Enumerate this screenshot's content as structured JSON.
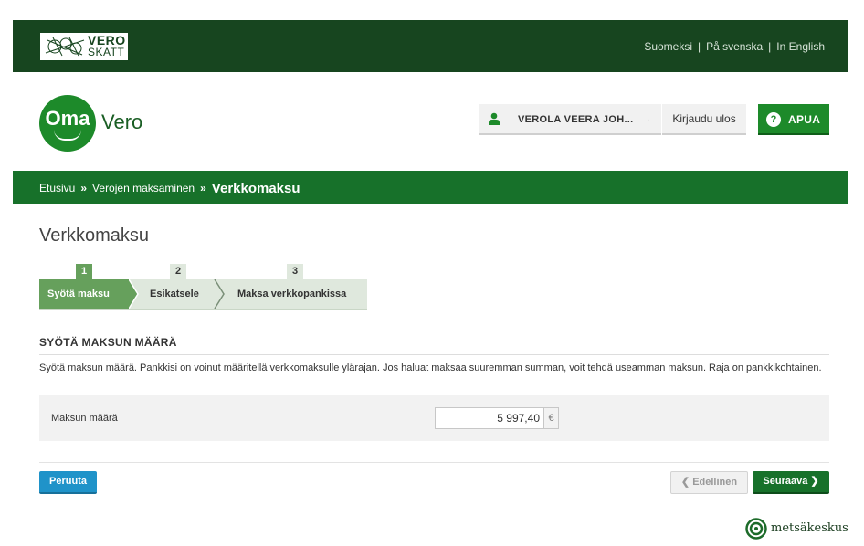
{
  "header": {
    "logo": {
      "line1": "VERO",
      "line2": "SKATT"
    },
    "languages": [
      "Suomeksi",
      "På svenska",
      "In English"
    ]
  },
  "app": {
    "logo_oma": "Oma",
    "logo_vero": "Vero",
    "user_name": "VEROLA VEERA JOH...",
    "user_menu_marker": ".",
    "logout_label": "Kirjaudu ulos",
    "help_label": "APUA",
    "help_glyph": "?"
  },
  "breadcrumb": {
    "items": [
      "Etusivu",
      "Verojen maksaminen"
    ],
    "separator": "»",
    "current": "Verkkomaksu"
  },
  "page": {
    "title": "Verkkomaksu"
  },
  "steps": [
    {
      "number": "1",
      "label": "Syötä maksu",
      "active": true
    },
    {
      "number": "2",
      "label": "Esikatsele",
      "active": false
    },
    {
      "number": "3",
      "label": "Maksa verkkopankissa",
      "active": false
    }
  ],
  "section": {
    "heading": "SYÖTÄ MAKSUN MÄÄRÄ",
    "description": "Syötä maksun määrä. Pankkisi on voinut määritellä verkkomaksulle ylärajan. Jos haluat maksaa suuremman summan, voit tehdä useamman maksun. Raja on pankkikohtainen."
  },
  "form": {
    "amount_label": "Maksun määrä",
    "amount_value": "5 997,40",
    "currency": "€"
  },
  "buttons": {
    "cancel": "Peruuta",
    "previous": "Edellinen",
    "previous_glyph": "❮",
    "next": "Seuraava",
    "next_glyph": "❯"
  },
  "watermark": {
    "text": "metsäkeskus"
  },
  "colors": {
    "topbar": "#17451f",
    "brand_green": "#1d8a2a",
    "crumb_bar": "#17712a",
    "step_active": "#66a05c",
    "cancel_blue": "#1f93c9"
  },
  "icons": {
    "user": "user-icon",
    "help": "help-icon",
    "emblem": "vero-emblem-icon",
    "watermark": "metsakeskus-logo-icon"
  }
}
